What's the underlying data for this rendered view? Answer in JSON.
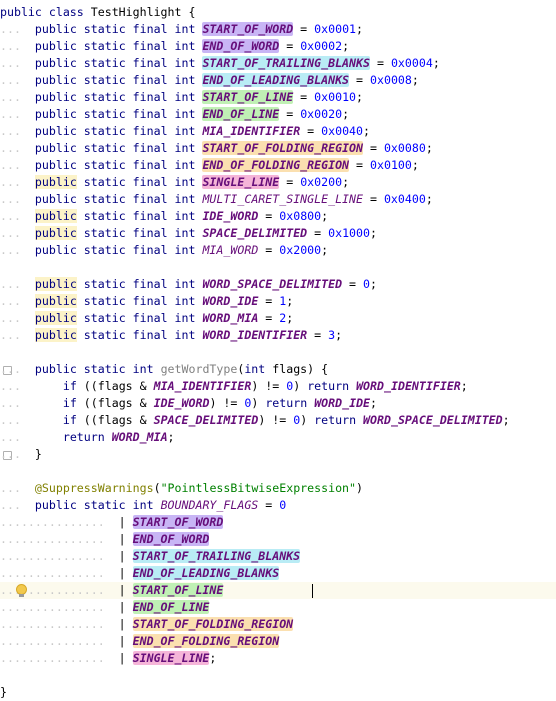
{
  "code": {
    "class_header": "public class TestHighlight {",
    "closing_brace": "}",
    "constants": [
      {
        "modifiers": "public static final int",
        "name": "START_OF_WORD",
        "value": "0x0001",
        "highlight": "#c8b5f5"
      },
      {
        "modifiers": "public static final int",
        "name": "END_OF_WORD",
        "value": "0x0002",
        "highlight": "#c8b5f5"
      },
      {
        "modifiers": "public static final int",
        "name": "START_OF_TRAILING_BLANKS",
        "value": "0x0004",
        "highlight": "#b9ecf5"
      },
      {
        "modifiers": "public static final int",
        "name": "END_OF_LEADING_BLANKS",
        "value": "0x0008",
        "highlight": "#b9ecf5"
      },
      {
        "modifiers": "public static final int",
        "name": "START_OF_LINE",
        "value": "0x0010",
        "highlight": "#c0f0b5"
      },
      {
        "modifiers": "public static final int",
        "name": "END_OF_LINE",
        "value": "0x0020",
        "highlight": "#c0f0b5"
      },
      {
        "modifiers": "public static final int",
        "name": "MIA_IDENTIFIER",
        "value": "0x0040",
        "highlight": ""
      },
      {
        "modifiers": "public static final int",
        "name": "START_OF_FOLDING_REGION",
        "value": "0x0080",
        "highlight": "#fbe0b0"
      },
      {
        "modifiers": "public static final int",
        "name": "END_OF_FOLDING_REGION",
        "value": "0x0100",
        "highlight": "#fbe0b0"
      },
      {
        "modifiers": "public static final int",
        "name": "SINGLE_LINE",
        "value": "0x0200",
        "highlight": "#f5b5d8"
      },
      {
        "modifiers": "public static final int",
        "name": "MULTI_CARET_SINGLE_LINE",
        "value": "0x0400",
        "highlight": ""
      },
      {
        "modifiers": "public static final int",
        "name": "IDE_WORD",
        "value": "0x0800",
        "highlight": ""
      },
      {
        "modifiers": "public static final int",
        "name": "SPACE_DELIMITED",
        "value": "0x1000",
        "highlight": ""
      },
      {
        "modifiers": "public static final int",
        "name": "MIA_WORD",
        "value": "0x2000",
        "highlight": ""
      }
    ],
    "word_types": [
      {
        "modifiers": "public static final int",
        "name": "WORD_SPACE_DELIMITED",
        "value": "0"
      },
      {
        "modifiers": "public static final int",
        "name": "WORD_IDE",
        "value": "1"
      },
      {
        "modifiers": "public static final int",
        "name": "WORD_MIA",
        "value": "2"
      },
      {
        "modifiers": "public static final int",
        "name": "WORD_IDENTIFIER",
        "value": "3"
      }
    ],
    "method": {
      "signature_kw": "public static int",
      "name": "getWordType",
      "param_type": "int",
      "param_name": "flags",
      "body": [
        {
          "flag": "MIA_IDENTIFIER",
          "result": "WORD_IDENTIFIER"
        },
        {
          "flag": "IDE_WORD",
          "result": "WORD_IDE"
        },
        {
          "flag": "SPACE_DELIMITED",
          "result": "WORD_SPACE_DELIMITED"
        }
      ],
      "return_value": "WORD_MIA"
    },
    "annotation": {
      "name": "@SuppressWarnings",
      "argument": "\"PointlessBitwiseExpression\""
    },
    "boundary": {
      "modifiers": "public static int",
      "name": "BOUNDARY_FLAGS",
      "first": "0",
      "terms": [
        {
          "name": "START_OF_WORD",
          "highlight": "#c8b5f5"
        },
        {
          "name": "END_OF_WORD",
          "highlight": "#c8b5f5"
        },
        {
          "name": "START_OF_TRAILING_BLANKS",
          "highlight": "#b9ecf5"
        },
        {
          "name": "END_OF_LEADING_BLANKS",
          "highlight": "#b9ecf5"
        },
        {
          "name": "START_OF_LINE",
          "highlight": "#c0f0b5"
        },
        {
          "name": "END_OF_LINE",
          "highlight": "#c0f0b5"
        },
        {
          "name": "START_OF_FOLDING_REGION",
          "highlight": "#fbe0b0"
        },
        {
          "name": "END_OF_FOLDING_REGION",
          "highlight": "#fbe0b0"
        },
        {
          "name": "SINGLE_LINE",
          "highlight": "#f5b5d8"
        }
      ]
    }
  },
  "colors": {
    "keyword": "#000080",
    "field": "#660e7a",
    "number": "#0000ff",
    "string": "#008000",
    "annotation": "#808000",
    "current_line": "#fcfaed",
    "public_highlight": "#fcf3c8"
  },
  "icons": [
    "fold-marker-icon",
    "intention-bulb-icon",
    "text-caret"
  ]
}
